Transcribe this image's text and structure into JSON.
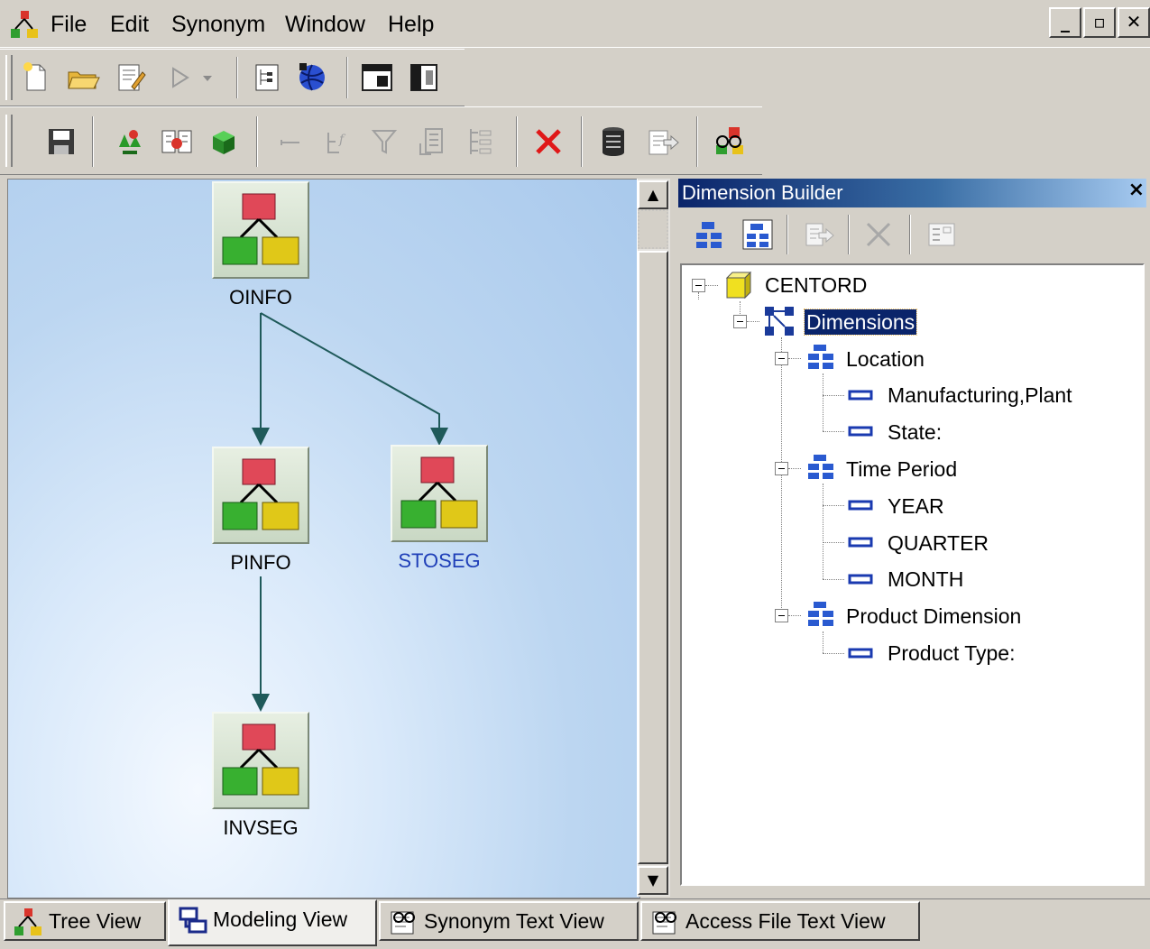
{
  "window": {
    "menu": [
      "File",
      "Edit",
      "Synonym",
      "Window",
      "Help"
    ],
    "controls": [
      "minimize",
      "restore",
      "close"
    ]
  },
  "toolbar1": {
    "buttons": [
      "new-icon",
      "open-icon",
      "edit-icon",
      "run-icon",
      "dropdown-arrow-icon",
      "tree-icon",
      "globe-icon",
      "window-icon",
      "split-icon"
    ]
  },
  "toolbar2": {
    "buttons": [
      "save-icon",
      "segment-icon",
      "join-icon",
      "cube-icon",
      "field-icon",
      "define-icon",
      "filter-icon",
      "compute-icon",
      "index-icon",
      "delete-icon",
      "database-icon",
      "export-icon",
      "glasses-icon"
    ]
  },
  "canvas": {
    "nodes": [
      "OINFO",
      "PINFO",
      "STOSEG",
      "INVSEG"
    ],
    "selected_node": "STOSEG"
  },
  "dimension_builder": {
    "title": "Dimension Builder",
    "close": "×",
    "tree": {
      "root": "CENTORD",
      "dimensions": "Dimensions",
      "location": "Location",
      "location_children": [
        "Manufacturing,Plant",
        "State:"
      ],
      "time_period": "Time Period",
      "time_children": [
        "YEAR",
        "QUARTER",
        "MONTH"
      ],
      "product_dimension": "Product Dimension",
      "product_children": [
        "Product Type:"
      ]
    }
  },
  "tabs": [
    "Tree View",
    "Modeling View",
    "Synonym Text View",
    "Access File Text View"
  ],
  "active_tab": "Modeling View",
  "colors": {
    "selection": "#0a246a",
    "selected_node_label": "#1f3fb8",
    "connector": "#1f5a5a"
  }
}
